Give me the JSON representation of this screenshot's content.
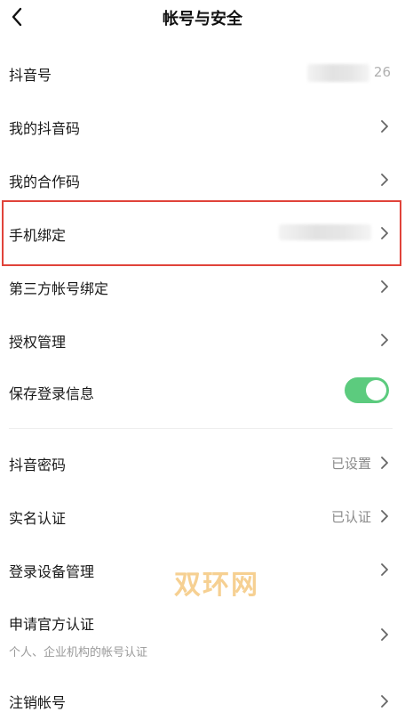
{
  "header": {
    "title": "帐号与安全",
    "back_icon": "chevron-left-icon"
  },
  "rows": {
    "douyin_id": {
      "label": "抖音号",
      "value_tail": "26"
    },
    "qr_code": {
      "label": "我的抖音码"
    },
    "collab_code": {
      "label": "我的合作码"
    },
    "phone_binding": {
      "label": "手机绑定"
    },
    "third_party": {
      "label": "第三方帐号绑定"
    },
    "authorization": {
      "label": "授权管理"
    },
    "save_login": {
      "label": "保存登录信息",
      "enabled": true
    },
    "password": {
      "label": "抖音密码",
      "value": "已设置"
    },
    "real_name": {
      "label": "实名认证",
      "value": "已认证"
    },
    "devices": {
      "label": "登录设备管理"
    },
    "official_verify": {
      "label": "申请官方认证",
      "sub": "个人、企业机构的帐号认证"
    },
    "deactivate": {
      "label": "注销帐号"
    }
  },
  "watermark": "双环网",
  "colors": {
    "highlight": "#e0433a",
    "toggle_on": "#5ccb7e",
    "watermark": "#f5c87f"
  }
}
